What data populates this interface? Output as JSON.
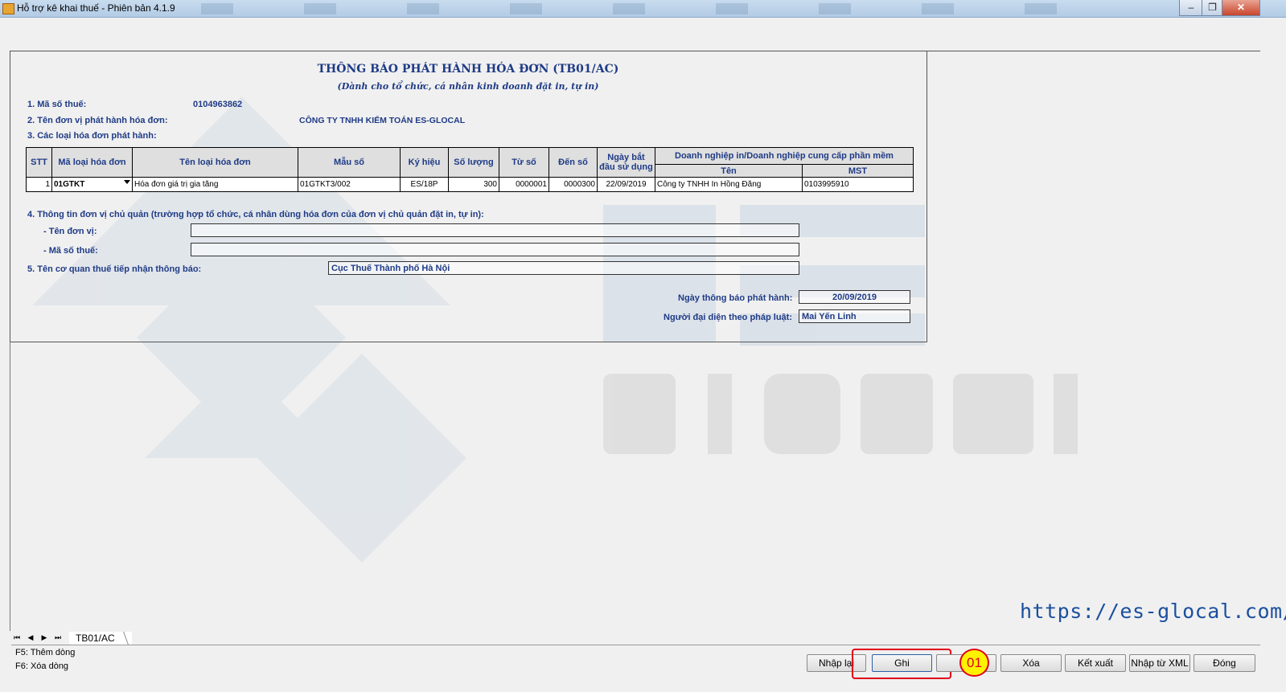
{
  "window": {
    "title": "Hỗ trợ kê khai thuế -  Phiên bản 4.1.9",
    "controls": [
      "–",
      "❐",
      "✕"
    ]
  },
  "form": {
    "title": "THÔNG BÁO PHÁT HÀNH HÓA ĐƠN (TB01/AC)",
    "subtitle": "(Dành cho tổ chức, cá nhân kinh doanh đặt in, tự in)",
    "tax_code_label": "1. Mã số thuế:",
    "tax_code": "0104963862",
    "issuer_label": "2. Tên đơn vị phát hành hóa đơn:",
    "issuer_name": "CÔNG TY TNHH KIỂM TOÁN ES-GLOCAL",
    "invoice_types_label": "3. Các loại hóa đơn phát hành:",
    "table": {
      "headers": {
        "stt": "STT",
        "code": "Mã loại hóa đơn",
        "name": "Tên loại hóa đơn",
        "template": "Mẫu số",
        "symbol": "Ký hiệu",
        "quantity": "Số lượng",
        "from": "Từ số",
        "to": "Đến số",
        "start_date": "Ngày bắt đầu sử dụng",
        "provider": "Doanh nghiệp in/Doanh nghiệp cung cấp phần mềm",
        "provider_name": "Tên",
        "provider_mst": "MST"
      },
      "rows": [
        {
          "stt": "1",
          "code": "01GTKT",
          "name": "Hóa đơn giá trị gia tăng",
          "template": "01GTKT3/002",
          "symbol": "ES/18P",
          "quantity": "300",
          "from": "0000001",
          "to": "0000300",
          "start_date": "22/09/2019",
          "provider_name": "Công ty TNHH In Hồng Đăng",
          "provider_mst": "0103995910"
        }
      ]
    },
    "parent_info_label": "4. Thông tin đơn vị chủ quản (trường hợp tổ chức, cá nhân dùng hóa đơn của đơn vị chủ quản đặt in, tự in):",
    "parent_name_label": "- Tên đơn vị:",
    "parent_name": "",
    "parent_tax_label": "- Mã số thuế:",
    "parent_tax": "",
    "tax_office_label": "5. Tên cơ quan thuế tiếp nhận thông báo:",
    "tax_office": "Cục Thuế Thành phố Hà Nội",
    "notice_date_label": "Ngày thông báo phát hành:",
    "notice_date": "20/09/2019",
    "representative_label": "Người đại diện theo pháp luật:",
    "representative": "Mai Yến Linh"
  },
  "sheet_tab": "TB01/AC",
  "hints": [
    "F5: Thêm dòng",
    "F6: Xóa dòng"
  ],
  "watermark_url": "https://es-glocal.com/",
  "buttons": {
    "reset": "Nhập lại",
    "save": "Ghi",
    "delete": "Xóa",
    "export": "Kết xuất",
    "import_xml": "Nhập từ XML",
    "close": "Đóng"
  },
  "step_marker": "01",
  "colors": {
    "label_blue": "#1f3b86",
    "highlight_red": "#e0001a",
    "marker_yellow": "#fff200"
  }
}
